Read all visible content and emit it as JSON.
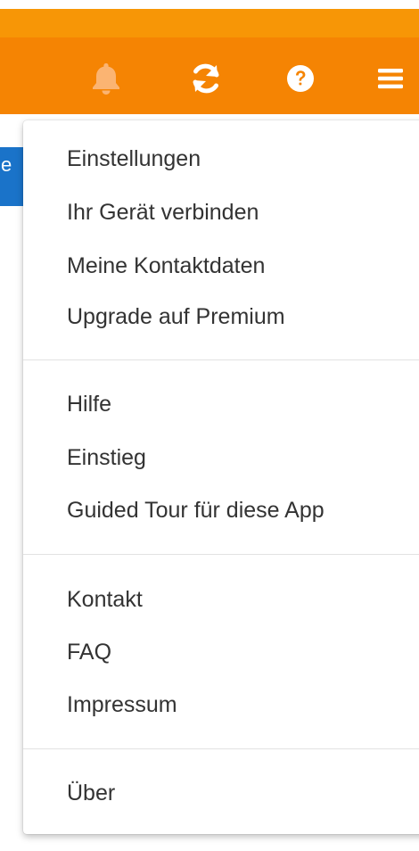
{
  "header": {
    "icons": [
      {
        "name": "bell-icon",
        "color": "#fbb472"
      },
      {
        "name": "refresh-icon",
        "color": "#ffffff"
      },
      {
        "name": "help-icon",
        "color": "#ffffff"
      },
      {
        "name": "hamburger-menu-icon",
        "color": "#ffffff"
      }
    ],
    "colors": {
      "bar": "#f58403",
      "bar_top": "#f79606"
    }
  },
  "side_tab": {
    "label": "e",
    "color": "#1a73c9"
  },
  "menu": {
    "groups": [
      {
        "items": [
          {
            "label": "Einstellungen"
          },
          {
            "label": "Ihr Gerät verbinden"
          },
          {
            "label": "Meine Kontaktdaten"
          },
          {
            "label": "Upgrade auf Premium"
          }
        ]
      },
      {
        "items": [
          {
            "label": "Hilfe"
          },
          {
            "label": "Einstieg"
          },
          {
            "label": "Guided Tour für diese App"
          }
        ]
      },
      {
        "items": [
          {
            "label": "Kontakt"
          },
          {
            "label": "FAQ"
          },
          {
            "label": "Impressum"
          }
        ]
      },
      {
        "items": [
          {
            "label": "Über"
          }
        ]
      }
    ]
  }
}
